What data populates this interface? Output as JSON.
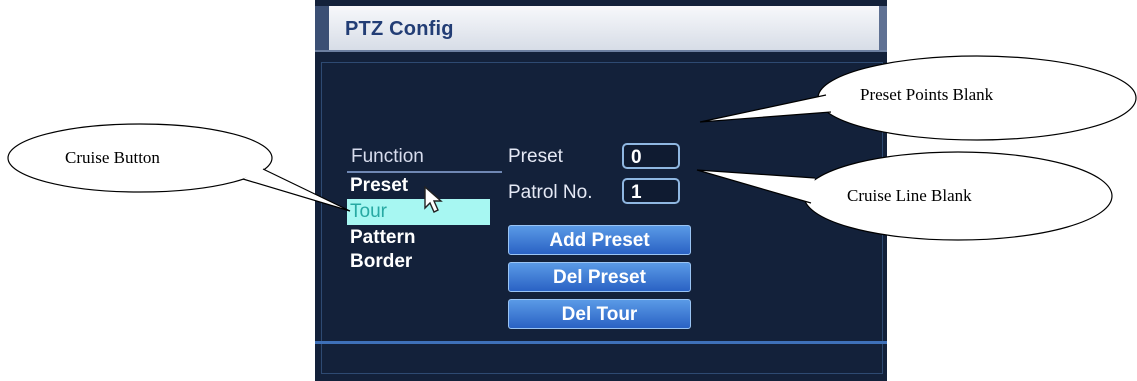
{
  "window": {
    "title": "PTZ Config"
  },
  "sidebar": {
    "header": "Function",
    "items": [
      {
        "label": "Preset",
        "active": false
      },
      {
        "label": "Tour",
        "active": true
      },
      {
        "label": "Pattern",
        "active": false
      },
      {
        "label": "Border",
        "active": false
      }
    ]
  },
  "form": {
    "preset_label": "Preset",
    "preset_value": "0",
    "patrol_label": "Patrol No.",
    "patrol_value": "1"
  },
  "buttons": {
    "add_preset": "Add Preset",
    "del_preset": "Del Preset",
    "del_tour": "Del Tour"
  },
  "callouts": {
    "preset_points": "Preset Points Blank",
    "cruise_line": "Cruise Line Blank",
    "cruise_button": "Cruise Button"
  },
  "icons": {
    "cursor": "mouse-pointer-icon"
  },
  "colors": {
    "highlight": "#a7f7f2",
    "button_blue": "#2a62c4",
    "panel_bg": "#13213a"
  }
}
